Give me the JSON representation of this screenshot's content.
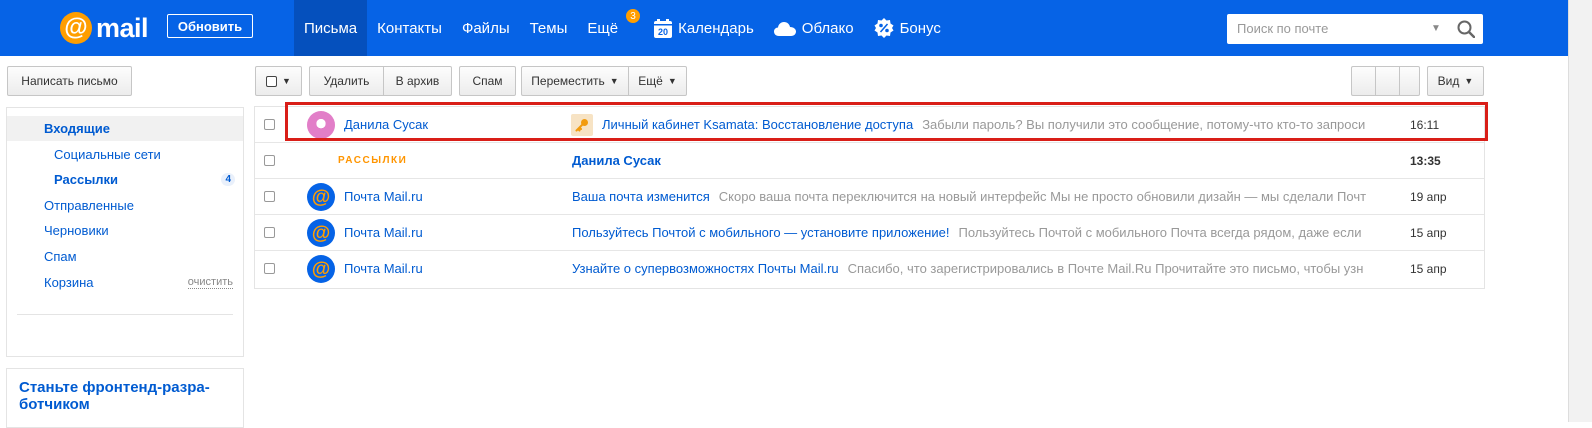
{
  "header": {
    "logo_text": "mail",
    "update_button": "Обновить",
    "nav": [
      {
        "label": "Письма"
      },
      {
        "label": "Контакты"
      },
      {
        "label": "Файлы"
      },
      {
        "label": "Темы"
      },
      {
        "label": "Ещё",
        "badge": "3"
      },
      {
        "label": "Календарь",
        "icon": "calendar-icon",
        "icon_text": "20"
      },
      {
        "label": "Облако",
        "icon": "cloud-icon"
      },
      {
        "label": "Бонус",
        "icon": "bonus-icon"
      }
    ],
    "search_placeholder": "Поиск по почте"
  },
  "toolbar": {
    "compose": "Написать письмо",
    "delete": "Удалить",
    "archive": "В архив",
    "spam": "Спам",
    "move": "Переместить",
    "more": "Ещё",
    "view": "Вид"
  },
  "sidebar": {
    "items": [
      {
        "label": "Входящие"
      },
      {
        "label": "Социальные сети"
      },
      {
        "label": "Рассылки",
        "count": "4"
      },
      {
        "label": "Отправленные"
      },
      {
        "label": "Черновики"
      },
      {
        "label": "Спам"
      },
      {
        "label": "Корзина",
        "action": "очистить"
      }
    ],
    "promo_title": "Станьте фронтенд-разра-ботчиком"
  },
  "messages": [
    {
      "sender": "Данила Сусак",
      "subject": "Личный кабинет Ksamata: Восстановление доступа",
      "snippet": "Забыли пароль? Вы получили это сообщение, потому-что кто-то запроси",
      "date": "16:11",
      "avatar": "pink"
    },
    {
      "sender": "РАССЫЛКИ",
      "subject": "Данила Сусак",
      "snippet": "",
      "date": "13:35"
    },
    {
      "sender": "Почта Mail.ru",
      "subject": "Ваша почта изменится",
      "snippet": "Скоро ваша почта переключится на новый интерфейс Мы не просто обновили дизайн — мы сделали Почт",
      "date": "19 апр",
      "avatar": "mail"
    },
    {
      "sender": "Почта Mail.ru",
      "subject": "Пользуйтесь Почтой с мобильного — установите приложение!",
      "snippet": "Пользуйтесь Почтой с мобильного Почта всегда рядом, даже если",
      "date": "15 апр",
      "avatar": "mail"
    },
    {
      "sender": "Почта Mail.ru",
      "subject": "Узнайте о супервозможностях Почты Mail.ru",
      "snippet": "Спасибо, что зарегистрировались в Почте Mail.Ru Прочитайте это письмо, чтобы узн",
      "date": "15 апр",
      "avatar": "mail"
    }
  ],
  "colors": {
    "brand": "#0663e6",
    "accent": "#ff9e00",
    "link": "#005bd1",
    "highlight": "#d91e18"
  }
}
